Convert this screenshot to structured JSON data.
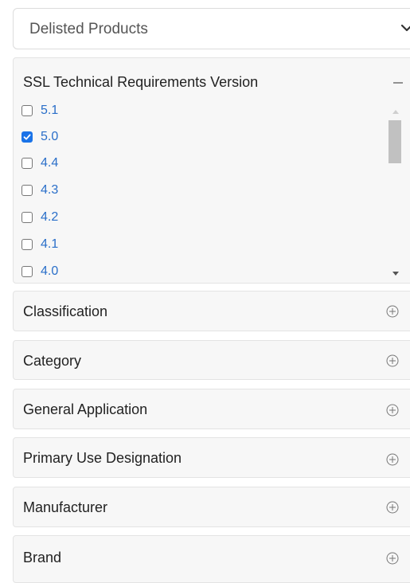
{
  "dropdown": {
    "value": "Delisted Products",
    "chevron_icon": "chevron-down-icon"
  },
  "ssl_panel": {
    "title": "SSL Technical Requirements Version",
    "collapse_icon": "minus-icon",
    "options": [
      {
        "label": "5.1",
        "checked": false
      },
      {
        "label": "5.0",
        "checked": true
      },
      {
        "label": "4.4",
        "checked": false
      },
      {
        "label": "4.3",
        "checked": false
      },
      {
        "label": "4.2",
        "checked": false
      },
      {
        "label": "4.1",
        "checked": false
      },
      {
        "label": "4.0",
        "checked": false
      }
    ]
  },
  "filters": [
    {
      "title": "Classification",
      "icon": "plus-circle-icon"
    },
    {
      "title": "Category",
      "icon": "plus-circle-icon"
    },
    {
      "title": "General Application",
      "icon": "plus-circle-icon"
    },
    {
      "title": "Primary Use Designation",
      "icon": "plus-circle-icon"
    },
    {
      "title": "Manufacturer",
      "icon": "plus-circle-icon"
    },
    {
      "title": "Brand",
      "icon": "plus-circle-icon"
    }
  ],
  "colors": {
    "link": "#2a6fc9",
    "checked": "#1a73e8",
    "panel_bg": "#f7f7f7"
  }
}
